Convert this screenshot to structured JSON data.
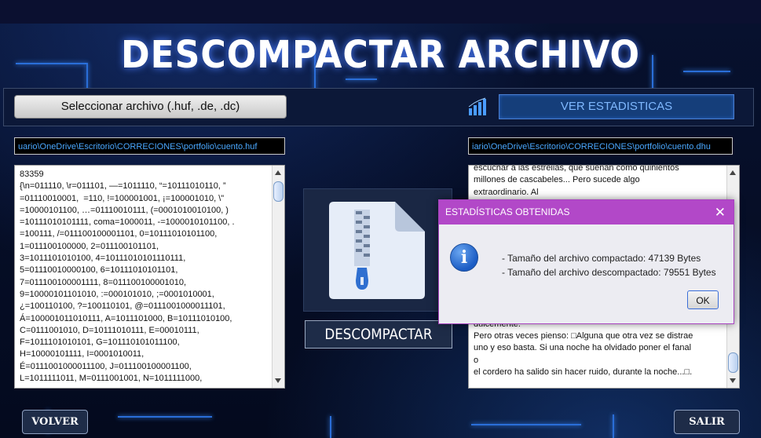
{
  "header": {
    "title": "DESCOMPACTAR ARCHIVO"
  },
  "toolbar": {
    "select_label": "Seleccionar archivo (.huf, .de, .dc)",
    "stats_label": "VER ESTADISTICAS",
    "stats_icon": "bar-chart-icon"
  },
  "paths": {
    "input": "uario\\OneDrive\\Escritorio\\CORRECIONES\\portfolio\\cuento.huf",
    "output": "iario\\OneDrive\\Escritorio\\CORRECIONES\\portfolio\\cuento.dhu"
  },
  "left_text": "83359\n{\\n=011110, \\r=011101, —=1011110, “=10111010110, ”\n=01110010001,  =110, !=100001001, ¡=100001010, \\\"\n=10000101100, …=01110010111, (=0001010010100, )\n=10111010101111, coma=1000011, -=1000010101100, .\n=100111, /=011100100001101, 0=10111010101100,\n1=011100100000, 2=011100101101,\n3=1011101010100, 4=10111010101110111,\n5=01110010000100, 6=10111010101101,\n7=011100100001111, 8=011100100001010,\n9=10000101101010, :=000101010, ;=0001010001,\n¿=100110100, ?=100110101, @=0111001000011101,\nÁ=100001011010111, A=1011101000, B=10111010100,\nC=0111001010, D=10111010111, E=00010111,\nF=1011101010101, G=101110101011100,\nH=10000101111, I=0001010011,\nÉ=0111001000011100, J=011100100001100,\nL=1011111011, M=0111001001, N=1011111000,",
  "right_text": "escuchar a las estrellas, que suenan como quinientos\nmillones de cascabeles... Pero sucede algo\nextraordinario. Al\n\n\n\n\n\n\n\n\n\n\ndulcemente.\nPero otras veces pienso: □Alguna que otra vez se distrae\nuno y eso basta. Si una noche ha olvidado poner el fanal\no\nel cordero ha salido sin hacer ruido, durante la noche...□.",
  "actions": {
    "decompress_label": "DESCOMPACTAR",
    "back_label": "VOLVER",
    "exit_label": "SALIR"
  },
  "dialog": {
    "title": "ESTADÍSTICAS OBTENIDAS",
    "close_glyph": "✕",
    "icon": "info-icon",
    "icon_glyph": "i",
    "line1": "- Tamaño del archivo compactado: 47139 Bytes",
    "line2": "- Tamaño del archivo descompactado: 79551 Bytes",
    "ok_label": "OK"
  },
  "colors": {
    "accent": "#b248c8",
    "stats_button": "#153e7a",
    "background": "#050a1c"
  }
}
